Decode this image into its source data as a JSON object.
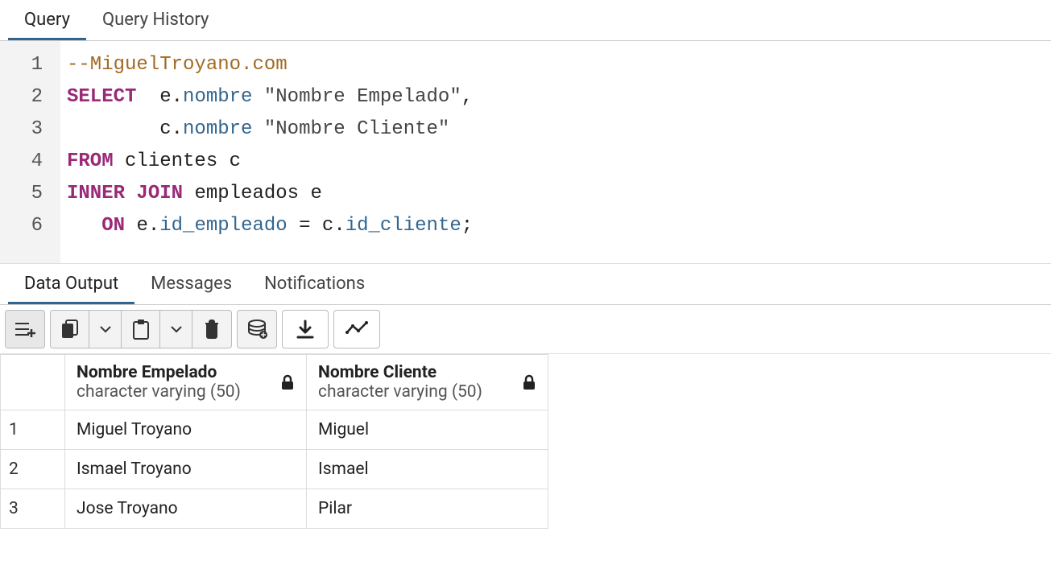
{
  "top_tabs": {
    "query": "Query",
    "history": "Query History"
  },
  "code": {
    "lines": [
      "1",
      "2",
      "3",
      "4",
      "5",
      "6"
    ],
    "l1_comment": "--MiguelTroyano.com",
    "l2_kw": "SELECT",
    "l2_a": "e",
    "l2_b": "nombre",
    "l2_str": "\"Nombre Empelado\"",
    "l2_comma": ",",
    "l3_a": "c",
    "l3_b": "nombre",
    "l3_str": "\"Nombre Cliente\"",
    "l4_kw": "FROM",
    "l4_rest": "clientes c",
    "l5_kw": "INNER JOIN",
    "l5_rest": "empleados e",
    "l6_kw": "ON",
    "l6_a": "e",
    "l6_b": "id_empleado",
    "l6_c": "c",
    "l6_d": "id_cliente",
    "eq": "=",
    "dot": ".",
    "semi": ";"
  },
  "output_tabs": {
    "data": "Data Output",
    "messages": "Messages",
    "notifications": "Notifications"
  },
  "columns": [
    {
      "title": "Nombre Empelado",
      "type": "character varying (50)"
    },
    {
      "title": "Nombre Cliente",
      "type": "character varying (50)"
    }
  ],
  "rows": [
    {
      "n": "1",
      "c1": "Miguel Troyano",
      "c2": "Miguel"
    },
    {
      "n": "2",
      "c1": "Ismael Troyano",
      "c2": "Ismael"
    },
    {
      "n": "3",
      "c1": "Jose Troyano",
      "c2": "Pilar"
    }
  ]
}
